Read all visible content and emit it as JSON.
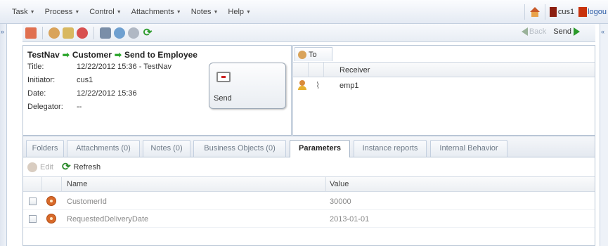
{
  "menubar": {
    "items": [
      "Task",
      "Process",
      "Control",
      "Attachments",
      "Notes",
      "Help"
    ],
    "user": "cus1",
    "logout": "logou"
  },
  "toolbar": {
    "back_label": "Back",
    "send_label": "Send"
  },
  "info": {
    "breadcrumb": [
      "TestNav",
      "Customer",
      "Send to Employee"
    ],
    "fields": [
      {
        "label": "Title:",
        "value": "12/22/2012 15:36 - TestNav"
      },
      {
        "label": "Initiator:",
        "value": "cus1"
      },
      {
        "label": "Date:",
        "value": "12/22/2012 15:36"
      },
      {
        "label": "Delegator:",
        "value": "--"
      }
    ],
    "send_button": "Send"
  },
  "to_panel": {
    "tab_label": "To",
    "column": "Receiver",
    "receivers": [
      "emp1"
    ]
  },
  "tabs": [
    "Folders",
    "Attachments (0)",
    "Notes (0)",
    "Business Objects (0)",
    "Parameters",
    "Instance reports",
    "Internal Behavior"
  ],
  "active_tab": "Parameters",
  "actions": {
    "edit": "Edit",
    "refresh": "Refresh"
  },
  "grid": {
    "columns": [
      "Name",
      "Value"
    ],
    "rows": [
      {
        "name": "CustomerId",
        "value": "30000"
      },
      {
        "name": "RequestedDeliveryDate",
        "value": "2013-01-01"
      }
    ]
  },
  "colors": {
    "accent_green": "#2a9a2a",
    "active_tab_text": "#222222",
    "inactive_text": "#888888"
  }
}
